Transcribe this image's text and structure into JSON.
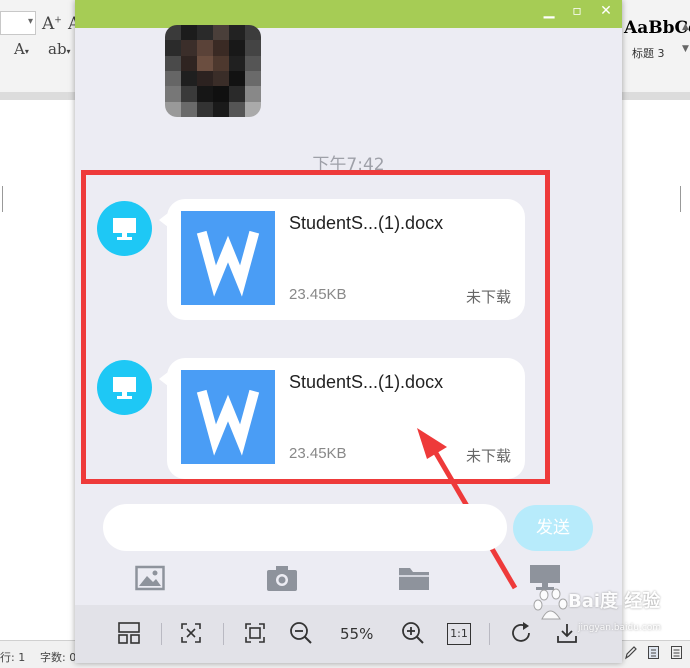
{
  "background_app": {
    "style_name": "AaBbCc",
    "style_label": "标题 3",
    "status_line": "行: 1",
    "status_words": "字数: 0"
  },
  "viewer": {
    "timestamp": "下午7:42",
    "messages": [
      {
        "file_name": "StudentS...(1).docx",
        "file_size": "23.45KB",
        "status": "未下载"
      },
      {
        "file_name": "StudentS...(1).docx",
        "file_size": "23.45KB",
        "status": "未下载"
      }
    ],
    "send_label": "发送",
    "zoom_label": "55%",
    "actual_size_label": "1:1"
  },
  "watermark": {
    "text": "Bai度 经验",
    "subtext": "jingyan.baidu.com"
  },
  "colors": {
    "titlebar": "#a6cc55",
    "highlight": "#ee3a3a",
    "file_tile": "#4a9df5",
    "avatar_icon": "#1ec8f5",
    "send_button": "#b7ebfb"
  },
  "icons": {
    "file_type": "wps-writer-w-icon",
    "sender": "computer-monitor-icon",
    "toolbar": [
      "image-icon",
      "camera-icon",
      "folder-icon",
      "computer-monitor-icon"
    ],
    "bottom_bar": [
      "thumbnails-icon",
      "fit-screen-icon",
      "crop-icon",
      "zoom-out-icon",
      "zoom-in-icon",
      "actual-size-icon",
      "rotate-icon",
      "download-icon"
    ]
  }
}
